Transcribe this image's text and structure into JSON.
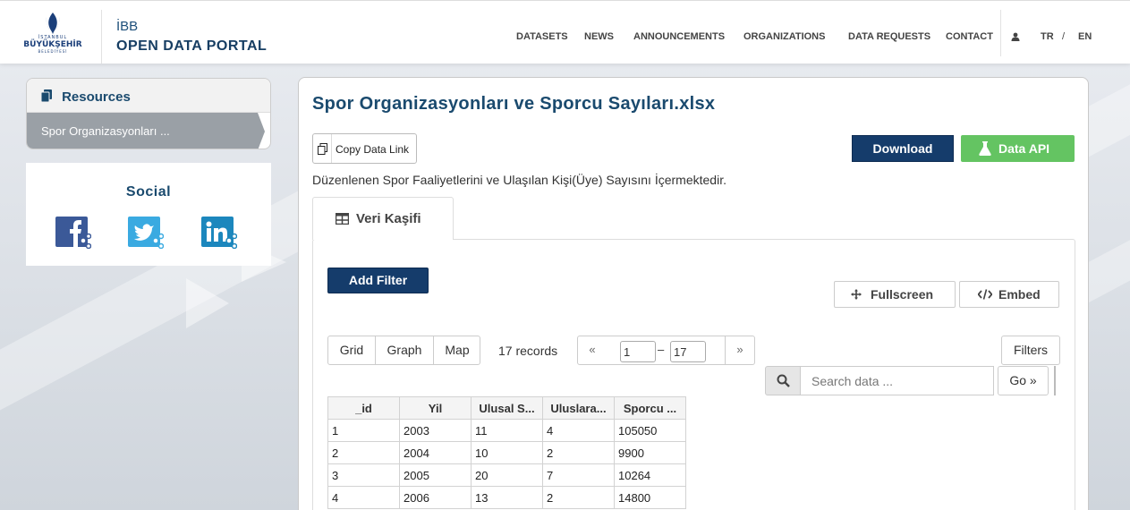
{
  "header": {
    "brand_line1": "İBB",
    "brand_line2": "OPEN DATA PORTAL",
    "logo": {
      "top": "İSTANBUL",
      "main": "BÜYÜKŞEHİR",
      "bottom": "BELEDİYESİ"
    },
    "nav": [
      "DATASETS",
      "NEWS",
      "ANNOUNCEMENTS",
      "ORGANIZATIONS",
      "DATA REQUESTS",
      "CONTACT"
    ],
    "lang_tr": "TR",
    "lang_sep": "/",
    "lang_en": "EN",
    "user_icon": "user-icon"
  },
  "sidebar": {
    "resources_title": "Resources",
    "resource_item": "Spor Organizasyonları ...",
    "social_title": "Social",
    "social_icons": [
      "facebook-icon",
      "twitter-icon",
      "linkedin-icon"
    ]
  },
  "main": {
    "title": "Spor Organizasyonları ve Sporcu Sayıları.xlsx",
    "copy_link_label": "Copy Data Link",
    "download_label": "Download",
    "data_api_label": "Data API",
    "description": "Düzenlenen Spor Faaliyetlerini ve Ulaşılan Kişi(Üye) Sayısını İçermektedir.",
    "tab_label": "Veri Kaşifi"
  },
  "explorer": {
    "add_filter": "Add Filter",
    "fullscreen": "Fullscreen",
    "embed": "Embed",
    "views": [
      "Grid",
      "Graph",
      "Map"
    ],
    "records": "17 records",
    "prev": "«",
    "next": "»",
    "page_from": "1",
    "page_to": "17",
    "dash": "–",
    "filters": "Filters",
    "search_placeholder": "Search data ...",
    "go": "Go »"
  },
  "table": {
    "columns": [
      "_id",
      "Yil",
      "Ulusal S...",
      "Uluslara...",
      "Sporcu ..."
    ],
    "rows": [
      [
        "1",
        "2003",
        "11",
        "4",
        "105050"
      ],
      [
        "2",
        "2004",
        "10",
        "2",
        "9900"
      ],
      [
        "3",
        "2005",
        "20",
        "7",
        "10264"
      ],
      [
        "4",
        "2006",
        "13",
        "2",
        "14800"
      ]
    ]
  },
  "colors": {
    "navy": "#153c6b",
    "green": "#64c462",
    "title_blue": "#1a4a6e"
  }
}
